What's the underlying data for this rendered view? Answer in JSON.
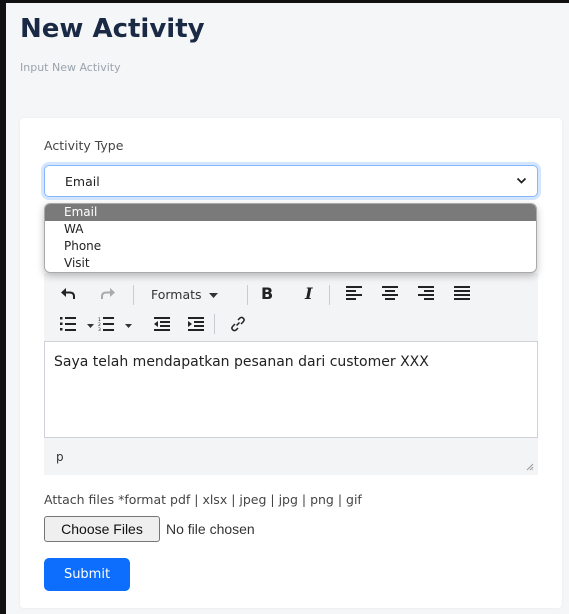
{
  "header": {
    "title": "New Activity",
    "subtitle": "Input New Activity"
  },
  "form": {
    "activity_type_label": "Activity Type",
    "activity_type_value": "Email",
    "activity_type_options": [
      "Email",
      "WA",
      "Phone",
      "Visit"
    ],
    "editor": {
      "formats_label": "Formats",
      "content": "Saya telah mendapatkan pesanan dari customer XXX",
      "status_path": "p"
    },
    "attach_label": "Attach files *format pdf | xlsx | jpeg | jpg | png | gif",
    "choose_files_label": "Choose Files",
    "no_file_text": "No file chosen",
    "submit_label": "Submit"
  },
  "colors": {
    "primary": "#0d6efd",
    "title": "#1a2a44",
    "selected_option": "#7a7a7a"
  },
  "icons": [
    "undo-icon",
    "redo-icon",
    "caret-down-icon",
    "bold-icon",
    "italic-icon",
    "align-left-icon",
    "align-center-icon",
    "align-right-icon",
    "align-justify-icon",
    "bullet-list-icon",
    "numbered-list-icon",
    "outdent-icon",
    "indent-icon",
    "link-icon",
    "chevron-down-icon",
    "resize-handle-icon"
  ]
}
